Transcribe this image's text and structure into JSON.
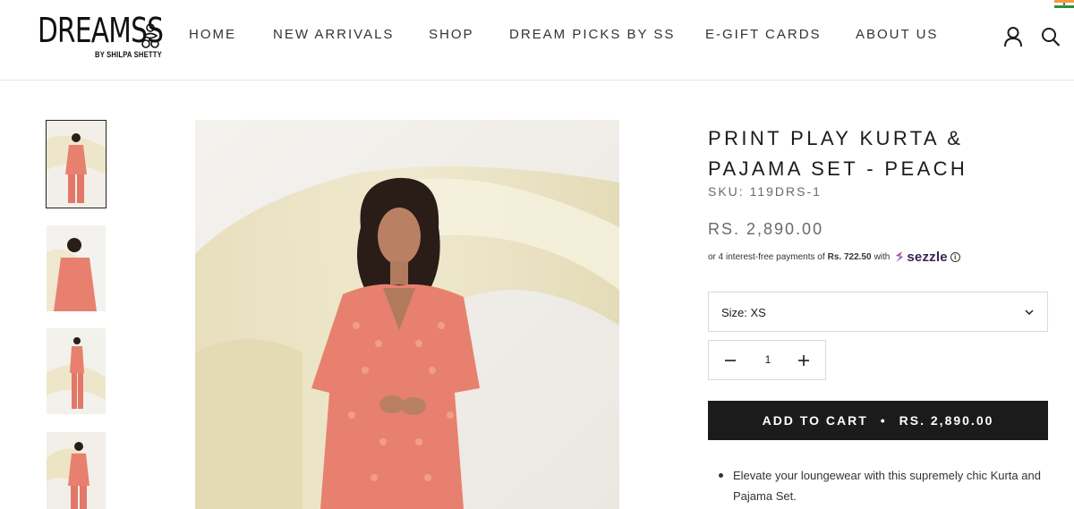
{
  "header": {
    "logo": {
      "main": "DREAMSS",
      "sub": "BY SHILPA SHETTY"
    },
    "nav": [
      {
        "label": "HOME"
      },
      {
        "label": "NEW ARRIVALS"
      },
      {
        "label": "SHOP"
      },
      {
        "label": "DREAM PICKS BY SS"
      },
      {
        "label": "E-GIFT CARDS"
      },
      {
        "label": "ABOUT US"
      }
    ],
    "icons": {
      "account": "user-icon",
      "search": "search-icon",
      "flag": "india-flag-icon"
    }
  },
  "gallery": {
    "thumbnails_count": 4,
    "active_index": 0
  },
  "product": {
    "title": "PRINT PLAY KURTA & PAJAMA SET - PEACH",
    "sku": "SKU: 119DRS-1",
    "price": "RS. 2,890.00",
    "installments": {
      "prefix": "or 4 interest-free payments of",
      "amount": "Rs. 722.50",
      "suffix": "with",
      "provider": "sezzle",
      "info": "i"
    },
    "size_select": {
      "label": "Size: XS"
    },
    "quantity": {
      "value": "1"
    },
    "add_to_cart": {
      "label": "ADD TO CART",
      "separator": "•",
      "price": "RS. 2,890.00"
    },
    "description": [
      "Elevate your loungewear with this supremely chic Kurta and Pajama Set."
    ]
  },
  "colors": {
    "accent_dark": "#1c1b1b",
    "muted_text": "#6a6a6a",
    "border": "#d9d9d9",
    "sezzle_purple": "#392558",
    "kurta_peach": "#e8806f",
    "drape_cream": "#ece4c2"
  }
}
